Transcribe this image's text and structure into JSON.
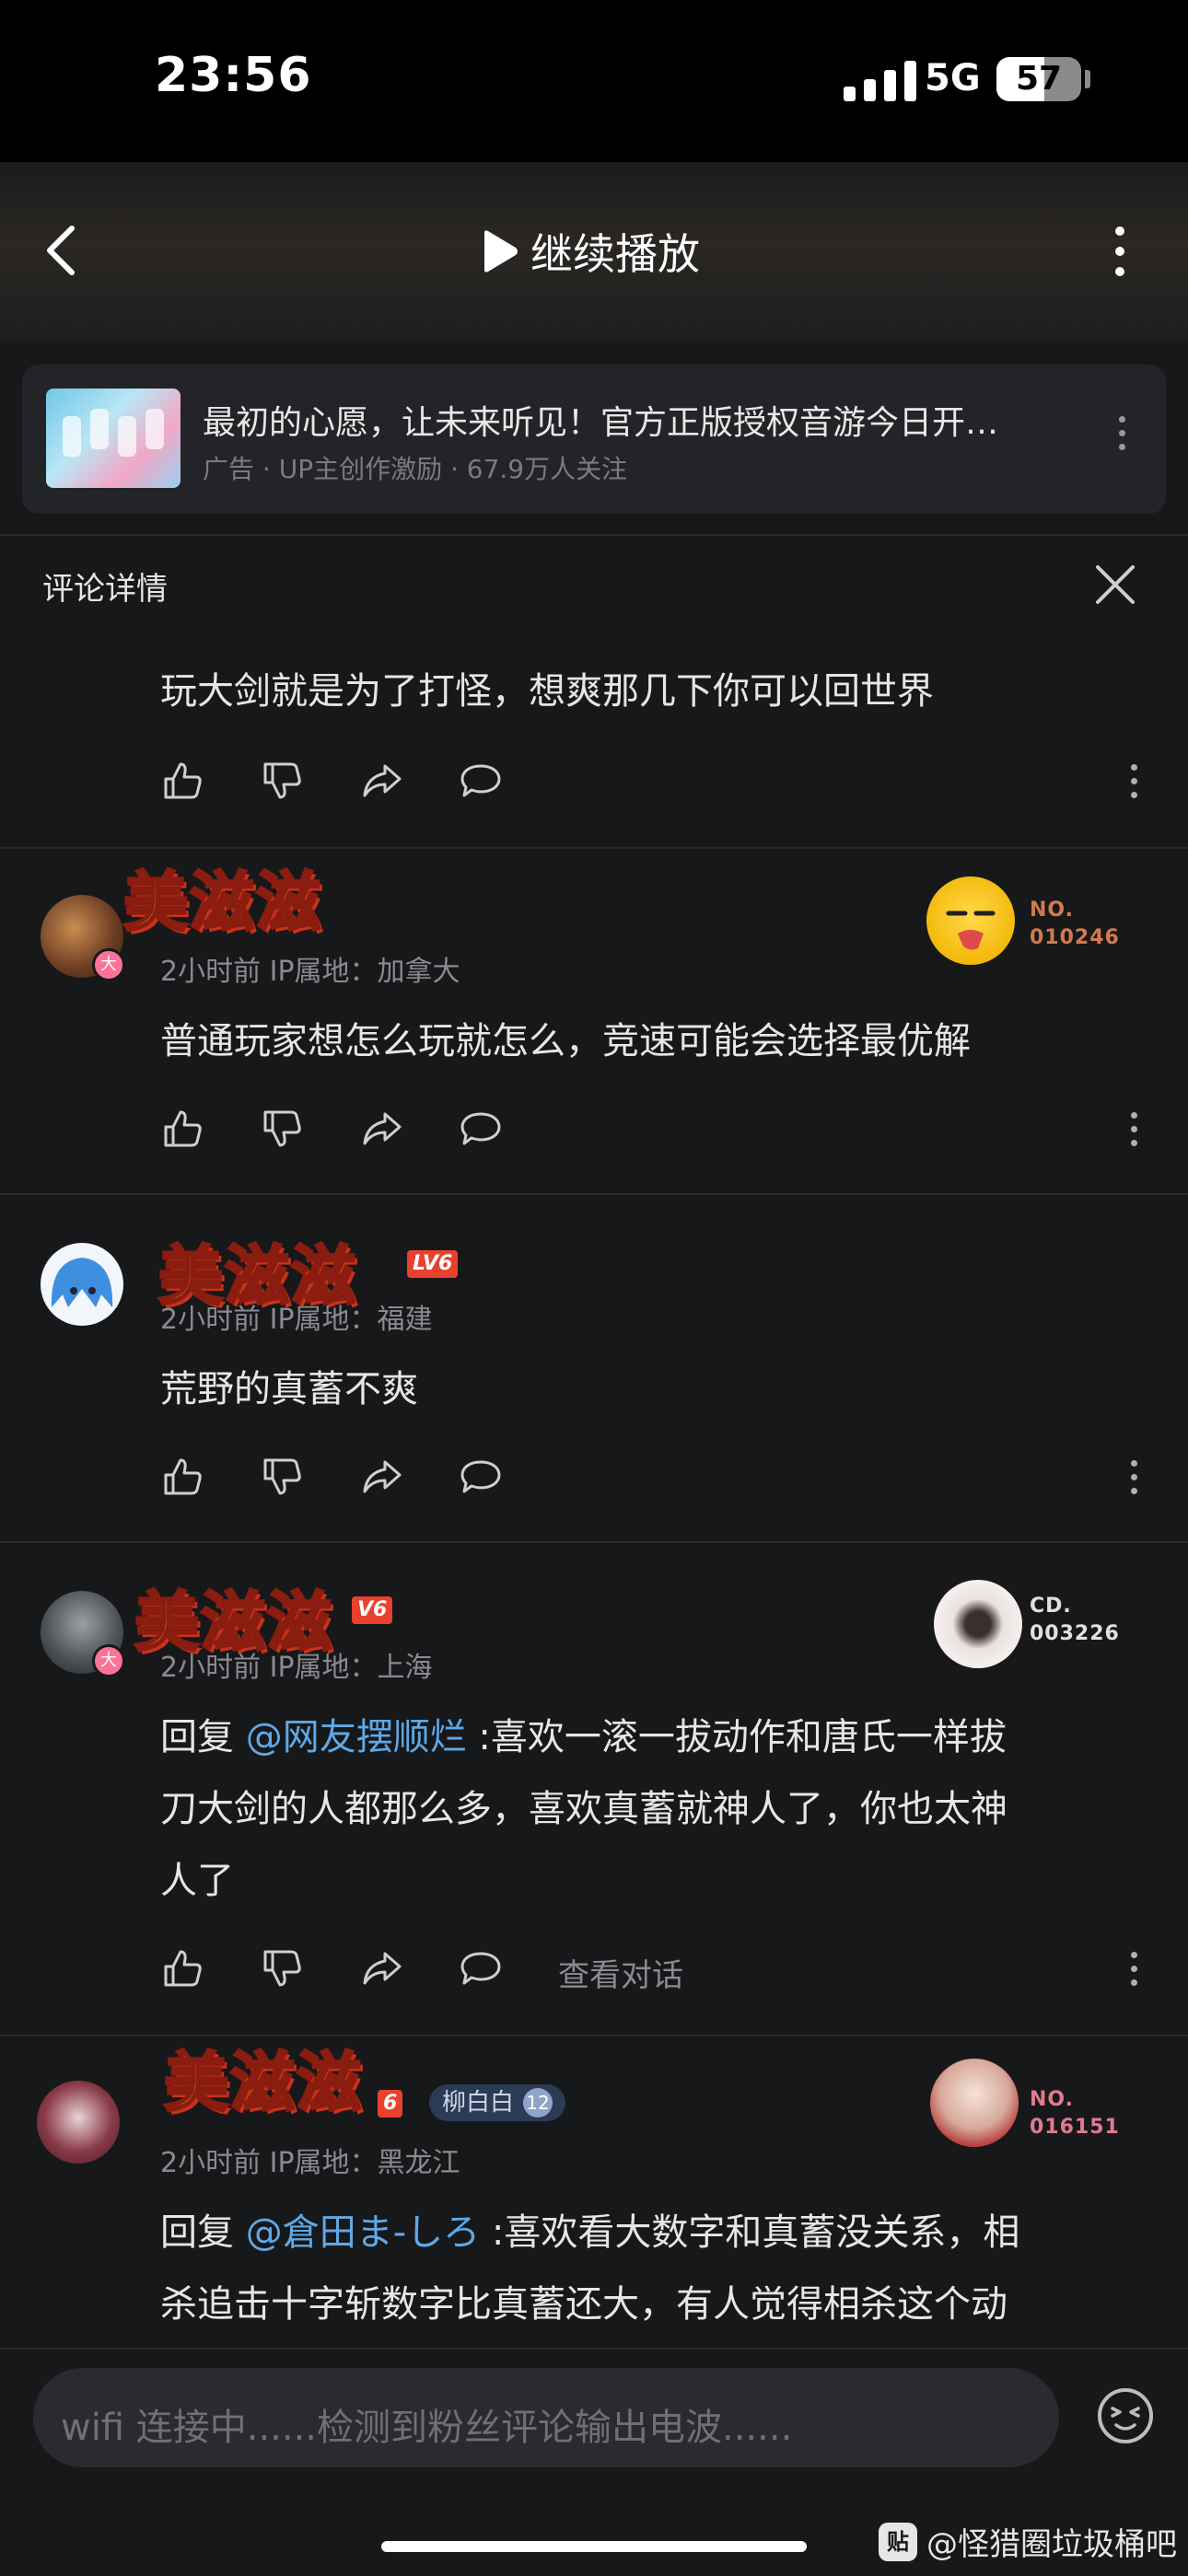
{
  "status_bar": {
    "time": "23:56",
    "network": "5G",
    "battery": "57",
    "battery_level": 0.57
  },
  "nav": {
    "title": "继续播放"
  },
  "ad": {
    "title": "最初的心愿，让未来听见！官方正版授权音游今日开…",
    "subtitle": "广告 · UP主创作激励 · 67.9万人关注"
  },
  "panel": {
    "title": "评论详情"
  },
  "comments": [
    {
      "text": "玩大剑就是为了打怪，想爽那几下你可以回世界"
    },
    {
      "name_badge": "美滋滋",
      "vip": "大",
      "meta": "2小时前  IP属地：加拿大",
      "card_label": "NO.",
      "card_number": "010246",
      "text": "普通玩家想怎么玩就怎么，竞速可能会选择最优解"
    },
    {
      "name_badge": "美滋滋",
      "level": "LV6",
      "meta": "2小时前  IP属地：福建",
      "text": "荒野的真蓄不爽"
    },
    {
      "name_badge": "美滋滋",
      "vip": "大",
      "level": "V6",
      "meta": "2小时前  IP属地：上海",
      "card_label": "CD.",
      "card_number": "003226",
      "reply_prefix": "回复 ",
      "mention": "@网友摆顺烂",
      "text_line1": " :喜欢一滚一拔动作和唐氏一样拔",
      "text_line2": "刀大剑的人都那么多，喜欢真蓄就神人了，你也太神",
      "text_line3": "人了",
      "view_conversation": "查看对话"
    },
    {
      "name_badge": "美滋滋",
      "level": "6",
      "fan_medal": "柳白白",
      "fan_level": "12",
      "meta": "2小时前  IP属地：黑龙江",
      "card_label": "NO.",
      "card_number": "016151",
      "reply_prefix": "回复 ",
      "mention": "@倉田ま-しろ",
      "text_line1": " :喜欢看大数字和真蓄没关系，相",
      "text_line2": "杀追击十字斩数字比真蓄还大，有人觉得相杀这个动"
    }
  ],
  "input": {
    "placeholder": "wifi 连接中......检测到粉丝评论输出电波......"
  },
  "watermark": {
    "badge": "贴",
    "text": "@怪猎圈垃圾桶吧"
  },
  "colors": {
    "mention": "#5fa8e6",
    "badge_yellow": "#ffd23a",
    "level_red": "#e8412e",
    "vip_pink": "#fb7299"
  }
}
